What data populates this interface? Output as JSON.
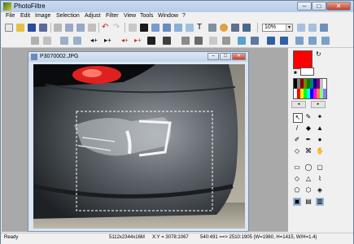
{
  "app": {
    "title": "PhotoFiltre"
  },
  "window_controls": {
    "minimize": "–",
    "maximize": "□",
    "close": "✕"
  },
  "menu": [
    "File",
    "Edit",
    "Image",
    "Selection",
    "Adjust",
    "Filter",
    "View",
    "Tools",
    "Window",
    "?"
  ],
  "toolbar": {
    "zoom_value": "10%"
  },
  "document": {
    "title": "P3070002.JPG"
  },
  "status": {
    "ready": "Ready",
    "dimensions": "5112x2344x16M",
    "xy": "X:Y = 3078:1067",
    "selection": "540:491 ==> 2510:1905 (W=1960, H=1415, W/H=1.4)"
  },
  "colors": {
    "foreground": "#ff0000",
    "background": "#ffffff"
  }
}
